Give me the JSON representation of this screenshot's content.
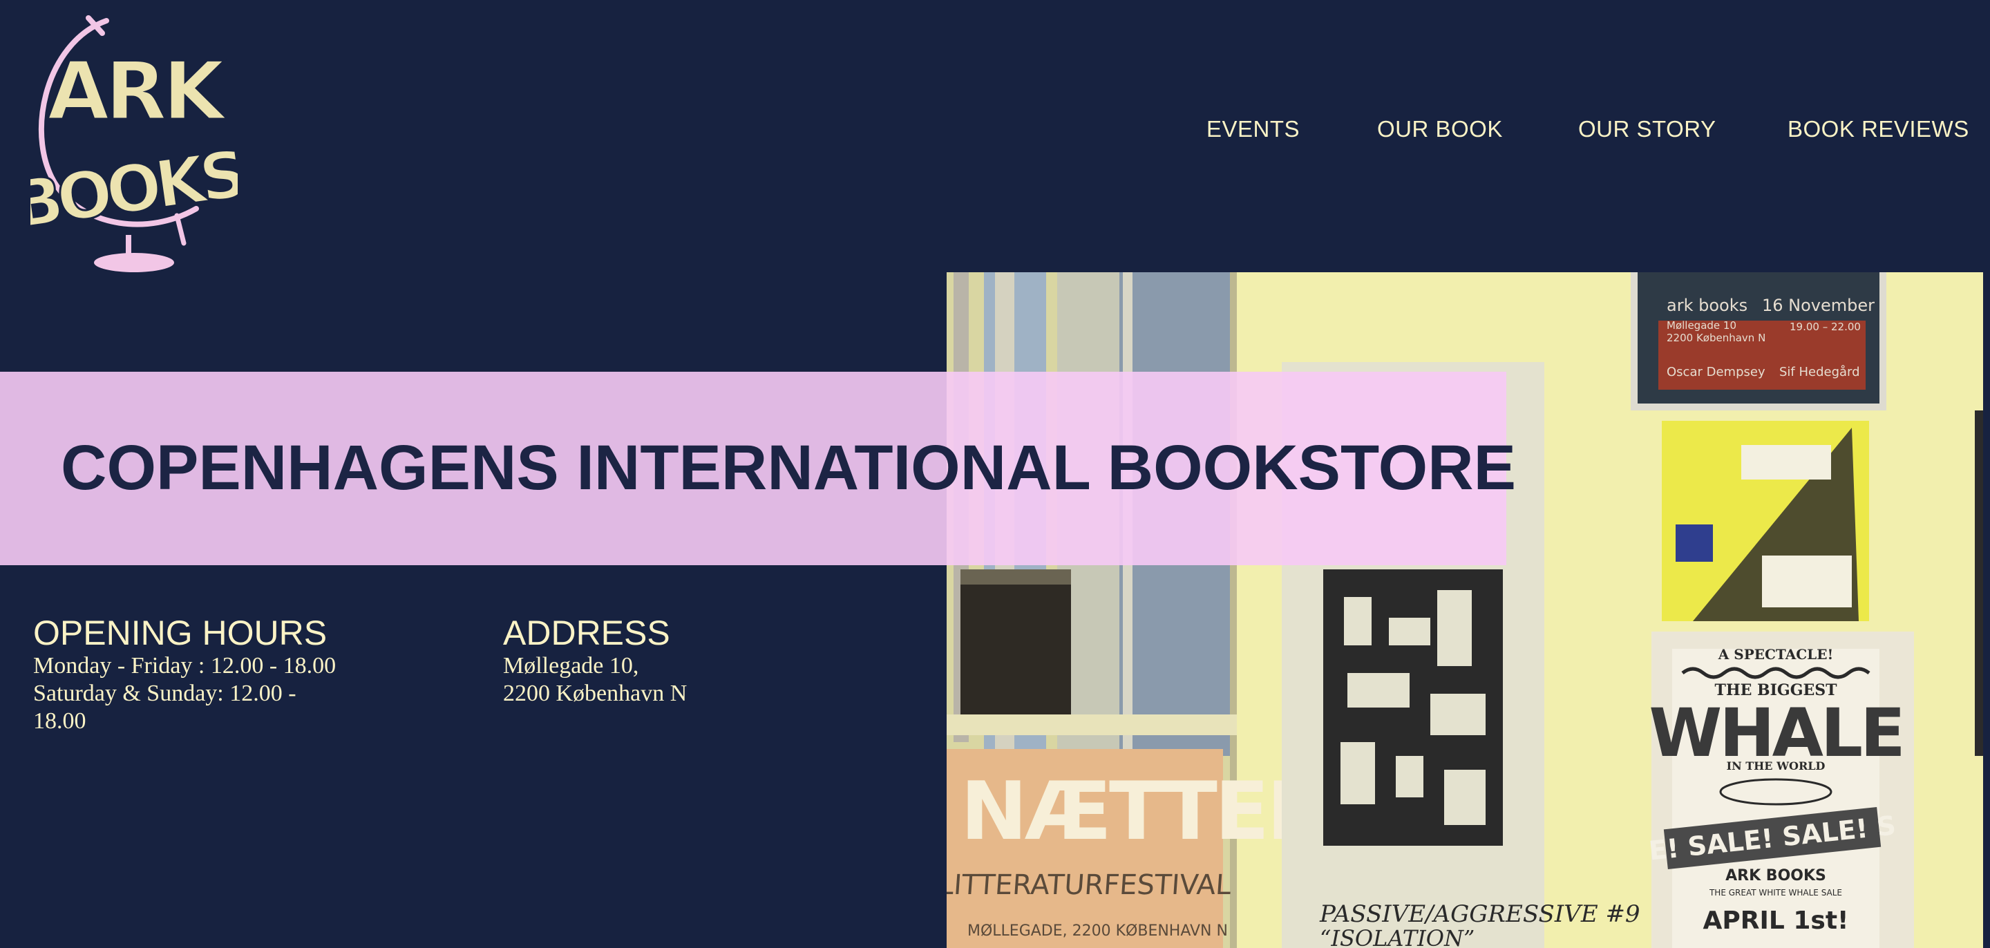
{
  "logo": {
    "line1": "ARK",
    "line2": "BOOKS"
  },
  "nav": {
    "items": [
      "EVENTS",
      "OUR BOOK",
      "OUR STORY",
      "BOOK REVIEWS"
    ]
  },
  "hero": {
    "title": "COPENHAGENS INTERNATIONAL BOOKSTORE"
  },
  "opening_hours": {
    "heading": "OPENING HOURS",
    "weekdays": "Monday - Friday : 12.00 - 18.00",
    "weekend": "Saturday & Sunday: 12.00 - 18.00"
  },
  "address": {
    "heading": "ADDRESS",
    "line1": "Møllegade 10,",
    "line2": "2200 København N"
  },
  "photo": {
    "poster_top": {
      "brand": "ark books",
      "date": "16 November",
      "street": "Møllegade 10",
      "city": "2200 København N",
      "time": "19.00 – 22.00",
      "name1": "Oscar Dempsey",
      "name2": "Sif Hedegård"
    },
    "poster_festival": {
      "title": "NÆTTER",
      "subtitle": "LITTERATURFESTIVAL",
      "address": "MØLLEGADE, 2200 KØBENHAVN N"
    },
    "poster_passive": {
      "title": "PASSIVE/AGGRESSIVE #9",
      "subtitle": "“ISOLATION”"
    },
    "poster_whale": {
      "top": "A SPECTACLE!",
      "line1": "THE BIGGEST",
      "big": "WHALE",
      "line3": "IN THE WORLD",
      "sale": "E! SALE! SALE! S",
      "brand": "ARK BOOKS",
      "tagline": "THE GREAT WHITE WHALE SALE",
      "date": "APRIL 1st!"
    }
  },
  "colors": {
    "background": "#172240",
    "cream": "#fbf3c6",
    "pink": "#f6caf5",
    "navy_text": "#1c2444",
    "logo_fill": "#ece3b0",
    "globe_pink": "#f2c6e6"
  }
}
